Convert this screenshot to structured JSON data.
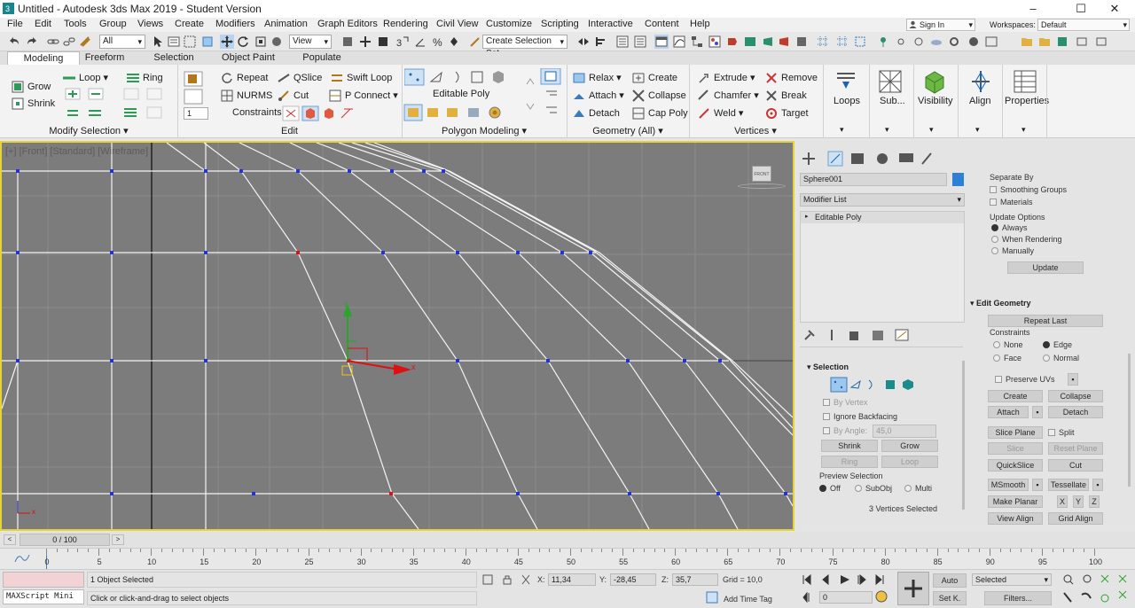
{
  "window": {
    "title": "Untitled - Autodesk 3ds Max 2019 - Student Version",
    "min": "–",
    "max": "☐",
    "close": "✕"
  },
  "menubar": [
    "File",
    "Edit",
    "Tools",
    "Group",
    "Views",
    "Create",
    "Modifiers",
    "Animation",
    "Graph Editors",
    "Rendering",
    "Civil View",
    "Customize",
    "Scripting",
    "Interactive",
    "Content",
    "Help"
  ],
  "account": {
    "signin": "Sign In",
    "workspaces_label": "Workspaces:",
    "workspace": "Default"
  },
  "toolbar": {
    "selection_filter": "All",
    "ref_coord": "View",
    "named_selection": "Create Selection Set"
  },
  "ribbon_tabs": [
    "Modeling",
    "Freeform",
    "Selection",
    "Object Paint",
    "Populate"
  ],
  "ribbon": {
    "modify_selection": {
      "grow": "Grow",
      "shrink": "Shrink",
      "loop": "Loop",
      "ring": "Ring",
      "footer": "Modify Selection"
    },
    "edit": {
      "repeat": "Repeat",
      "qslice": "QSlice",
      "swift_loop": "Swift Loop",
      "nurms": "NURMS",
      "cut": "Cut",
      "p_connect": "P Connect",
      "constraints": "Constraints:",
      "spinner": "1",
      "footer": "Edit"
    },
    "polygon_modeling": {
      "mode": "Editable Poly",
      "footer": "Polygon Modeling"
    },
    "geometry": {
      "relax": "Relax",
      "create": "Create",
      "attach": "Attach",
      "collapse": "Collapse",
      "detach": "Detach",
      "cap_poly": "Cap Poly",
      "footer": "Geometry (All)"
    },
    "vertices": {
      "extrude": "Extrude",
      "remove": "Remove",
      "chamfer": "Chamfer",
      "break": "Break",
      "weld": "Weld",
      "target": "Target",
      "footer": "Vertices"
    },
    "big": {
      "loops": "Loops",
      "sub": "Sub...",
      "visibility": "Visibility",
      "align": "Align",
      "properties": "Properties"
    }
  },
  "viewport": {
    "label": "[+] [Front] [Standard] [Wireframe]",
    "axis_x": "x",
    "axis_y": "y",
    "cube": "FRONT"
  },
  "command_panel": {
    "object_name": "Sphere001",
    "object_color": "#2e7fd6",
    "modifier_list": "Modifier List",
    "stack_item": "Editable Poly",
    "selection": {
      "title": "Selection",
      "by_vertex": "By Vertex",
      "ignore_backfacing": "Ignore Backfacing",
      "by_angle": "By Angle:",
      "angle": "45,0",
      "shrink": "Shrink",
      "grow": "Grow",
      "ring": "Ring",
      "loop": "Loop",
      "preview": "Preview Selection",
      "off": "Off",
      "subobj": "SubObj",
      "multi": "Multi",
      "status": "3 Vertices Selected"
    },
    "right": {
      "separate_by": "Separate By",
      "smoothing_groups": "Smoothing Groups",
      "materials": "Materials",
      "update_options": "Update Options",
      "always": "Always",
      "when_rendering": "When Rendering",
      "manually": "Manually",
      "update": "Update",
      "edit_geometry": "Edit Geometry",
      "repeat_last": "Repeat Last",
      "constraints": "Constraints",
      "none": "None",
      "edge": "Edge",
      "face": "Face",
      "normal": "Normal",
      "preserve_uvs": "Preserve UVs",
      "create": "Create",
      "collapse": "Collapse",
      "attach": "Attach",
      "detach": "Detach",
      "slice_plane": "Slice Plane",
      "split": "Split",
      "slice": "Slice",
      "reset_plane": "Reset Plane",
      "quickslice": "QuickSlice",
      "cut": "Cut",
      "msmooth": "MSmooth",
      "tessellate": "Tessellate",
      "make_planar": "Make Planar",
      "x": "X",
      "y": "Y",
      "z": "Z",
      "view_align": "View Align",
      "grid_align": "Grid Align"
    }
  },
  "timeline": {
    "frame": "0 / 100",
    "ticks": [
      "0",
      "5",
      "10",
      "15",
      "20",
      "25",
      "30",
      "35",
      "40",
      "45",
      "50",
      "55",
      "60",
      "65",
      "70",
      "75",
      "80",
      "85",
      "90",
      "95",
      "100"
    ]
  },
  "status": {
    "maxscript": "MAXScript Mini",
    "line1": "1 Object Selected",
    "line2": "Click or click-and-drag to select objects",
    "x_label": "X:",
    "x": "11,34",
    "y_label": "Y:",
    "y": "-28,45",
    "z_label": "Z:",
    "z": "35,7",
    "grid": "Grid = 10,0",
    "add_time_tag": "Add Time Tag",
    "auto": "Auto",
    "setk": "Set K.",
    "key_mode": "Selected",
    "filters": "Filters...",
    "frame_field": "0"
  }
}
